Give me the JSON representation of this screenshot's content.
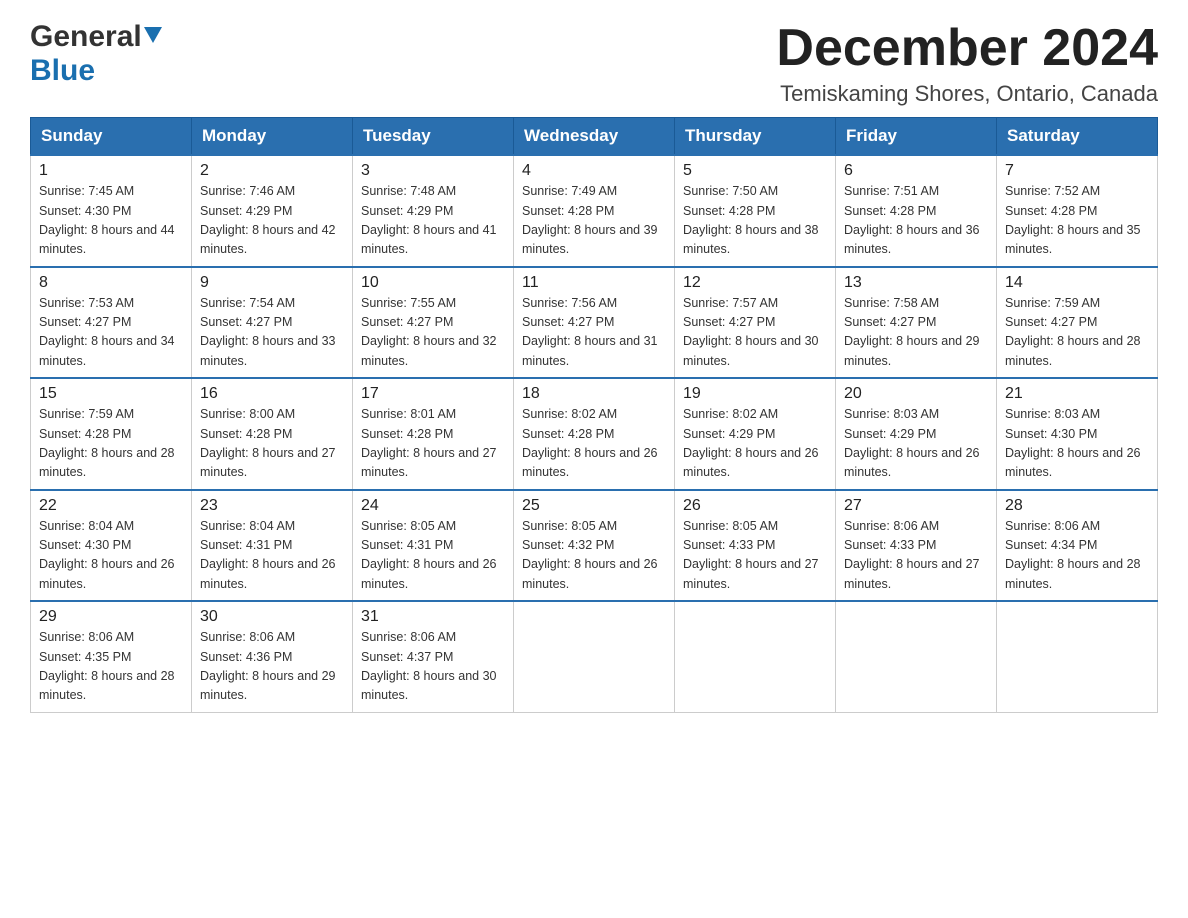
{
  "header": {
    "logo_general": "General",
    "logo_blue": "Blue",
    "month_title": "December 2024",
    "subtitle": "Temiskaming Shores, Ontario, Canada"
  },
  "weekdays": [
    "Sunday",
    "Monday",
    "Tuesday",
    "Wednesday",
    "Thursday",
    "Friday",
    "Saturday"
  ],
  "weeks": [
    [
      {
        "day": "1",
        "sunrise": "7:45 AM",
        "sunset": "4:30 PM",
        "daylight": "8 hours and 44 minutes."
      },
      {
        "day": "2",
        "sunrise": "7:46 AM",
        "sunset": "4:29 PM",
        "daylight": "8 hours and 42 minutes."
      },
      {
        "day": "3",
        "sunrise": "7:48 AM",
        "sunset": "4:29 PM",
        "daylight": "8 hours and 41 minutes."
      },
      {
        "day": "4",
        "sunrise": "7:49 AM",
        "sunset": "4:28 PM",
        "daylight": "8 hours and 39 minutes."
      },
      {
        "day": "5",
        "sunrise": "7:50 AM",
        "sunset": "4:28 PM",
        "daylight": "8 hours and 38 minutes."
      },
      {
        "day": "6",
        "sunrise": "7:51 AM",
        "sunset": "4:28 PM",
        "daylight": "8 hours and 36 minutes."
      },
      {
        "day": "7",
        "sunrise": "7:52 AM",
        "sunset": "4:28 PM",
        "daylight": "8 hours and 35 minutes."
      }
    ],
    [
      {
        "day": "8",
        "sunrise": "7:53 AM",
        "sunset": "4:27 PM",
        "daylight": "8 hours and 34 minutes."
      },
      {
        "day": "9",
        "sunrise": "7:54 AM",
        "sunset": "4:27 PM",
        "daylight": "8 hours and 33 minutes."
      },
      {
        "day": "10",
        "sunrise": "7:55 AM",
        "sunset": "4:27 PM",
        "daylight": "8 hours and 32 minutes."
      },
      {
        "day": "11",
        "sunrise": "7:56 AM",
        "sunset": "4:27 PM",
        "daylight": "8 hours and 31 minutes."
      },
      {
        "day": "12",
        "sunrise": "7:57 AM",
        "sunset": "4:27 PM",
        "daylight": "8 hours and 30 minutes."
      },
      {
        "day": "13",
        "sunrise": "7:58 AM",
        "sunset": "4:27 PM",
        "daylight": "8 hours and 29 minutes."
      },
      {
        "day": "14",
        "sunrise": "7:59 AM",
        "sunset": "4:27 PM",
        "daylight": "8 hours and 28 minutes."
      }
    ],
    [
      {
        "day": "15",
        "sunrise": "7:59 AM",
        "sunset": "4:28 PM",
        "daylight": "8 hours and 28 minutes."
      },
      {
        "day": "16",
        "sunrise": "8:00 AM",
        "sunset": "4:28 PM",
        "daylight": "8 hours and 27 minutes."
      },
      {
        "day": "17",
        "sunrise": "8:01 AM",
        "sunset": "4:28 PM",
        "daylight": "8 hours and 27 minutes."
      },
      {
        "day": "18",
        "sunrise": "8:02 AM",
        "sunset": "4:28 PM",
        "daylight": "8 hours and 26 minutes."
      },
      {
        "day": "19",
        "sunrise": "8:02 AM",
        "sunset": "4:29 PM",
        "daylight": "8 hours and 26 minutes."
      },
      {
        "day": "20",
        "sunrise": "8:03 AM",
        "sunset": "4:29 PM",
        "daylight": "8 hours and 26 minutes."
      },
      {
        "day": "21",
        "sunrise": "8:03 AM",
        "sunset": "4:30 PM",
        "daylight": "8 hours and 26 minutes."
      }
    ],
    [
      {
        "day": "22",
        "sunrise": "8:04 AM",
        "sunset": "4:30 PM",
        "daylight": "8 hours and 26 minutes."
      },
      {
        "day": "23",
        "sunrise": "8:04 AM",
        "sunset": "4:31 PM",
        "daylight": "8 hours and 26 minutes."
      },
      {
        "day": "24",
        "sunrise": "8:05 AM",
        "sunset": "4:31 PM",
        "daylight": "8 hours and 26 minutes."
      },
      {
        "day": "25",
        "sunrise": "8:05 AM",
        "sunset": "4:32 PM",
        "daylight": "8 hours and 26 minutes."
      },
      {
        "day": "26",
        "sunrise": "8:05 AM",
        "sunset": "4:33 PM",
        "daylight": "8 hours and 27 minutes."
      },
      {
        "day": "27",
        "sunrise": "8:06 AM",
        "sunset": "4:33 PM",
        "daylight": "8 hours and 27 minutes."
      },
      {
        "day": "28",
        "sunrise": "8:06 AM",
        "sunset": "4:34 PM",
        "daylight": "8 hours and 28 minutes."
      }
    ],
    [
      {
        "day": "29",
        "sunrise": "8:06 AM",
        "sunset": "4:35 PM",
        "daylight": "8 hours and 28 minutes."
      },
      {
        "day": "30",
        "sunrise": "8:06 AM",
        "sunset": "4:36 PM",
        "daylight": "8 hours and 29 minutes."
      },
      {
        "day": "31",
        "sunrise": "8:06 AM",
        "sunset": "4:37 PM",
        "daylight": "8 hours and 30 minutes."
      },
      null,
      null,
      null,
      null
    ]
  ],
  "labels": {
    "sunrise": "Sunrise:",
    "sunset": "Sunset:",
    "daylight": "Daylight:"
  }
}
